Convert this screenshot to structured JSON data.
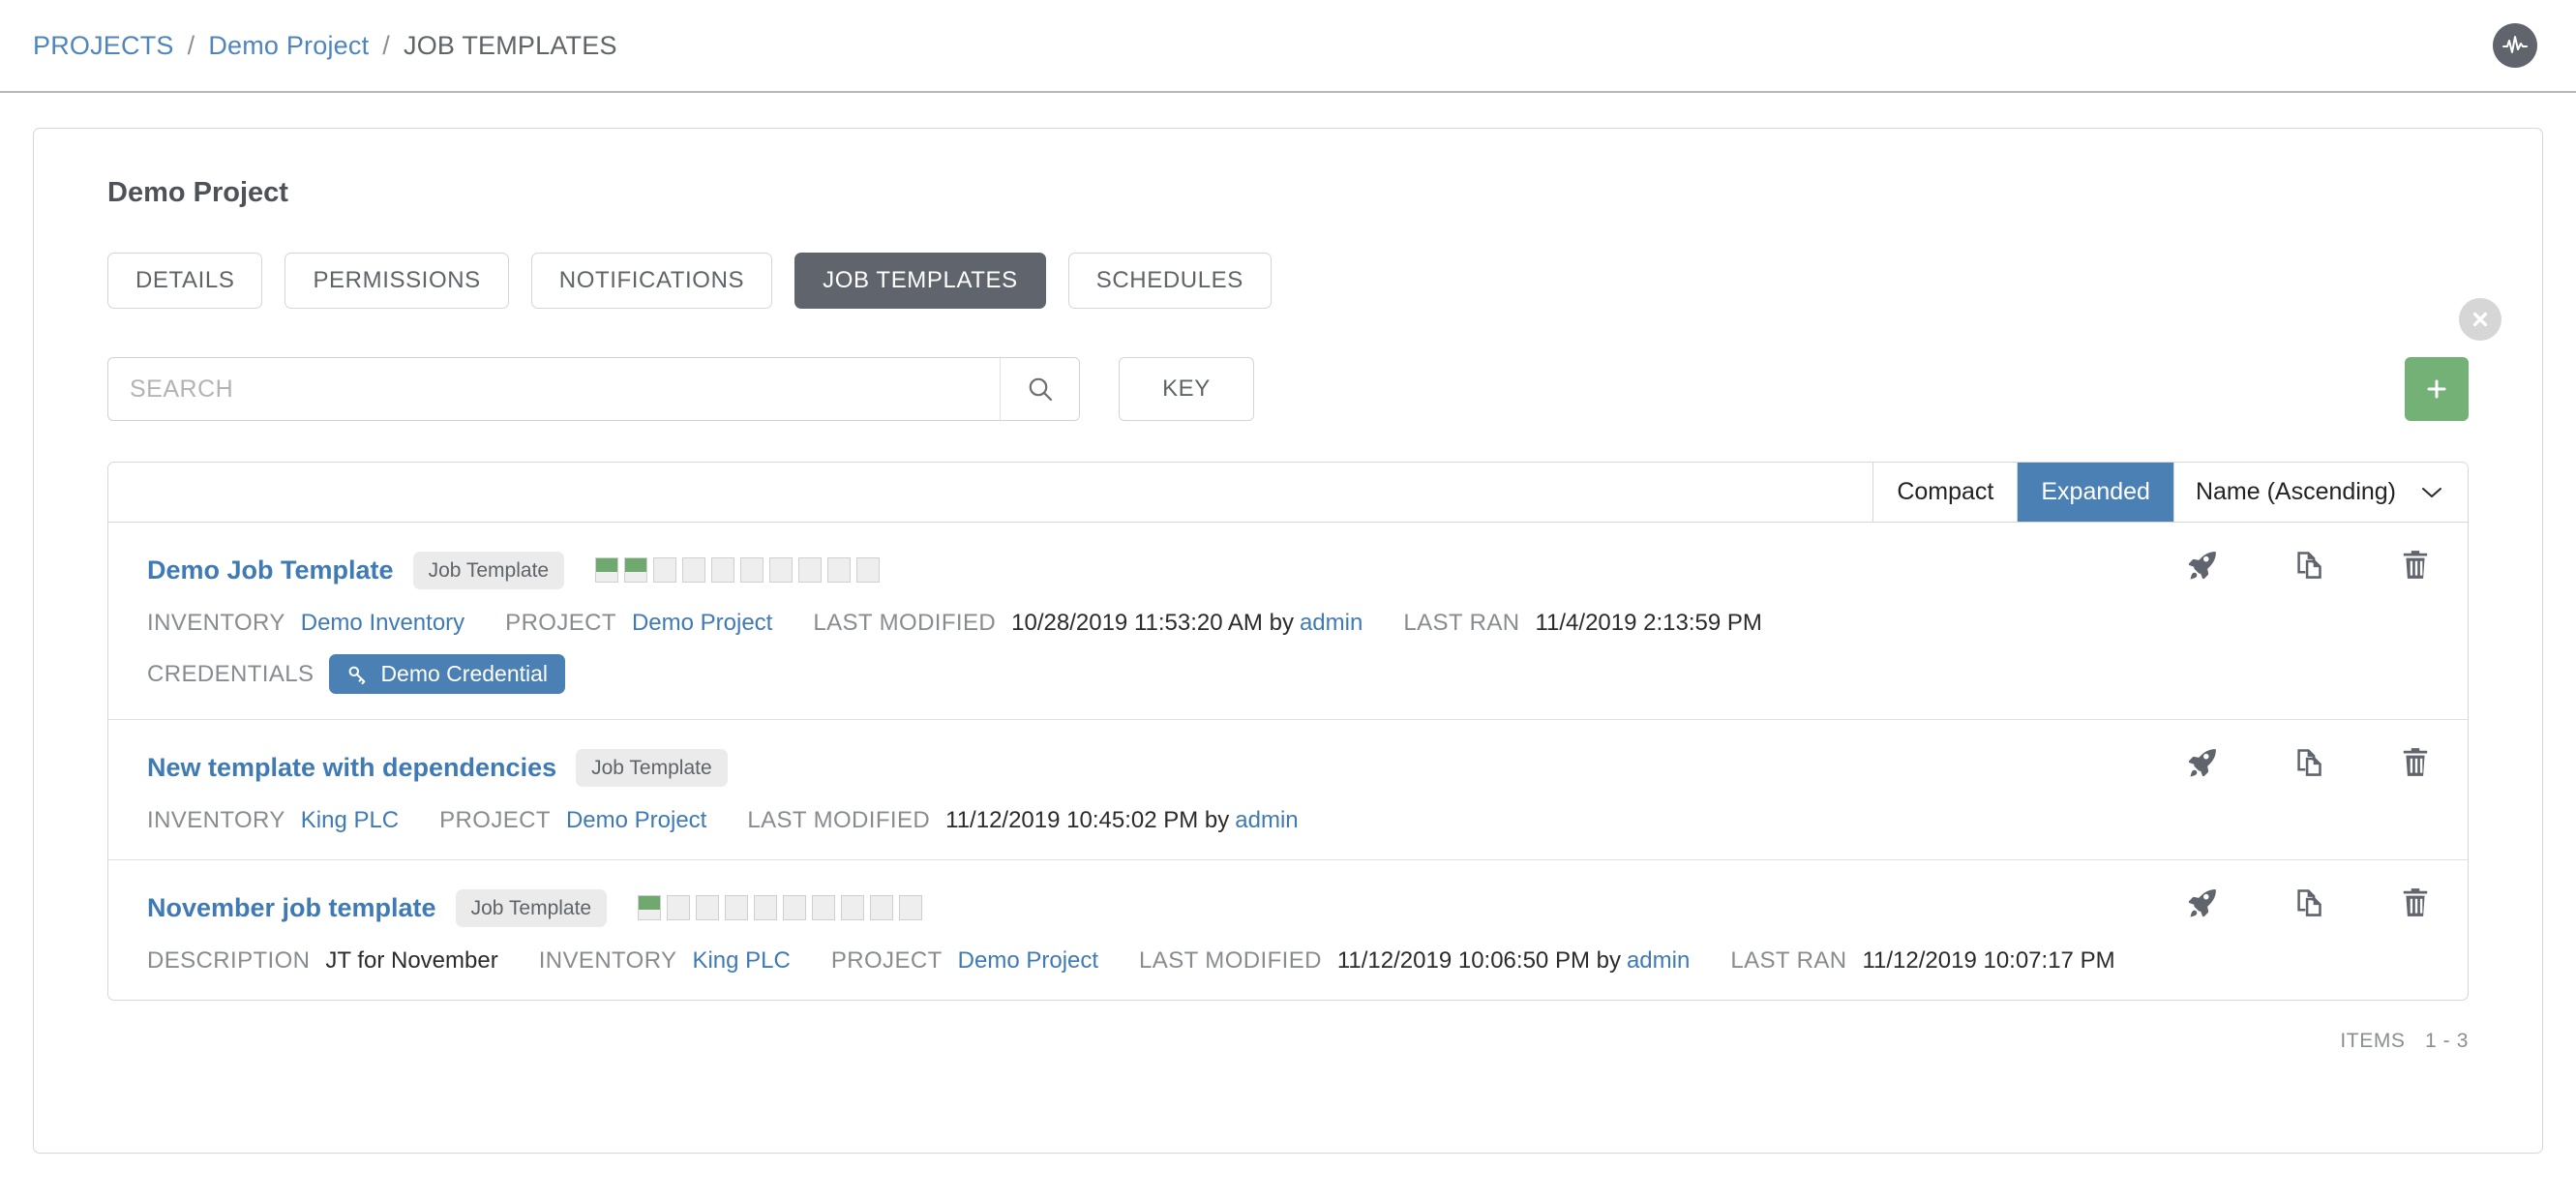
{
  "breadcrumb": {
    "items": [
      {
        "label": "PROJECTS",
        "type": "link"
      },
      {
        "label": "Demo Project",
        "type": "link"
      },
      {
        "label": "JOB TEMPLATES",
        "type": "current"
      }
    ],
    "separator": "/"
  },
  "header": {
    "activity_icon": "activity-stream-icon"
  },
  "card": {
    "title": "Demo Project",
    "close_icon": "close-circle-icon"
  },
  "tabs": [
    {
      "label": "DETAILS",
      "active": false
    },
    {
      "label": "PERMISSIONS",
      "active": false
    },
    {
      "label": "NOTIFICATIONS",
      "active": false
    },
    {
      "label": "JOB TEMPLATES",
      "active": true
    },
    {
      "label": "SCHEDULES",
      "active": false
    }
  ],
  "toolbar": {
    "search_value": "",
    "search_placeholder": "SEARCH",
    "search_icon": "search-icon",
    "key_label": "KEY",
    "add_label": "+",
    "add_icon": "plus-icon",
    "add_color": "#73b177"
  },
  "list_controls": {
    "compact_label": "Compact",
    "expanded_label": "Expanded",
    "active_view": "Expanded",
    "sort_label": "Name (Ascending)",
    "sort_icon": "chevron-down-icon",
    "accent_color": "#4a80b4"
  },
  "rows": [
    {
      "name": "Demo Job Template",
      "badge": "Job Template",
      "sparkline": {
        "total": 10,
        "statuses": [
          "ok",
          "ok",
          "empty",
          "empty",
          "empty",
          "empty",
          "empty",
          "empty",
          "empty",
          "empty"
        ]
      },
      "meta": [
        {
          "label": "INVENTORY",
          "value": "Demo Inventory",
          "link": true
        },
        {
          "label": "PROJECT",
          "value": "Demo Project",
          "link": true
        },
        {
          "label": "LAST MODIFIED",
          "value": "10/28/2019 11:53:20 AM by ",
          "link": false,
          "suffix_link": "admin"
        },
        {
          "label": "LAST RAN",
          "value": "11/4/2019 2:13:59 PM",
          "link": false
        }
      ],
      "credentials": {
        "label": "CREDENTIALS",
        "items": [
          {
            "name": "Demo Credential",
            "icon": "key-icon"
          }
        ]
      },
      "actions": [
        {
          "name": "launch",
          "icon": "rocket-icon"
        },
        {
          "name": "copy",
          "icon": "copy-icon"
        },
        {
          "name": "delete",
          "icon": "trash-icon"
        }
      ]
    },
    {
      "name": "New template with dependencies",
      "badge": "Job Template",
      "sparkline": {
        "total": 0,
        "statuses": []
      },
      "meta": [
        {
          "label": "INVENTORY",
          "value": "King PLC",
          "link": true
        },
        {
          "label": "PROJECT",
          "value": "Demo Project",
          "link": true
        },
        {
          "label": "LAST MODIFIED",
          "value": "11/12/2019 10:45:02 PM by ",
          "link": false,
          "suffix_link": "admin"
        }
      ],
      "credentials": null,
      "actions": [
        {
          "name": "launch",
          "icon": "rocket-icon"
        },
        {
          "name": "copy",
          "icon": "copy-icon"
        },
        {
          "name": "delete",
          "icon": "trash-icon"
        }
      ]
    },
    {
      "name": "November job template",
      "badge": "Job Template",
      "sparkline": {
        "total": 10,
        "statuses": [
          "ok",
          "empty",
          "empty",
          "empty",
          "empty",
          "empty",
          "empty",
          "empty",
          "empty",
          "empty"
        ]
      },
      "meta": [
        {
          "label": "DESCRIPTION",
          "value": "JT for November",
          "link": false
        },
        {
          "label": "INVENTORY",
          "value": "King PLC",
          "link": true
        },
        {
          "label": "PROJECT",
          "value": "Demo Project",
          "link": true
        },
        {
          "label": "LAST MODIFIED",
          "value": "11/12/2019 10:06:50 PM by ",
          "link": false,
          "suffix_link": "admin"
        },
        {
          "label": "LAST RAN",
          "value": "11/12/2019 10:07:17 PM",
          "link": false
        }
      ],
      "credentials": null,
      "actions": [
        {
          "name": "launch",
          "icon": "rocket-icon"
        },
        {
          "name": "copy",
          "icon": "copy-icon"
        },
        {
          "name": "delete",
          "icon": "trash-icon"
        }
      ]
    }
  ],
  "footer": {
    "items_label": "ITEMS",
    "items_range": "1 - 3"
  }
}
